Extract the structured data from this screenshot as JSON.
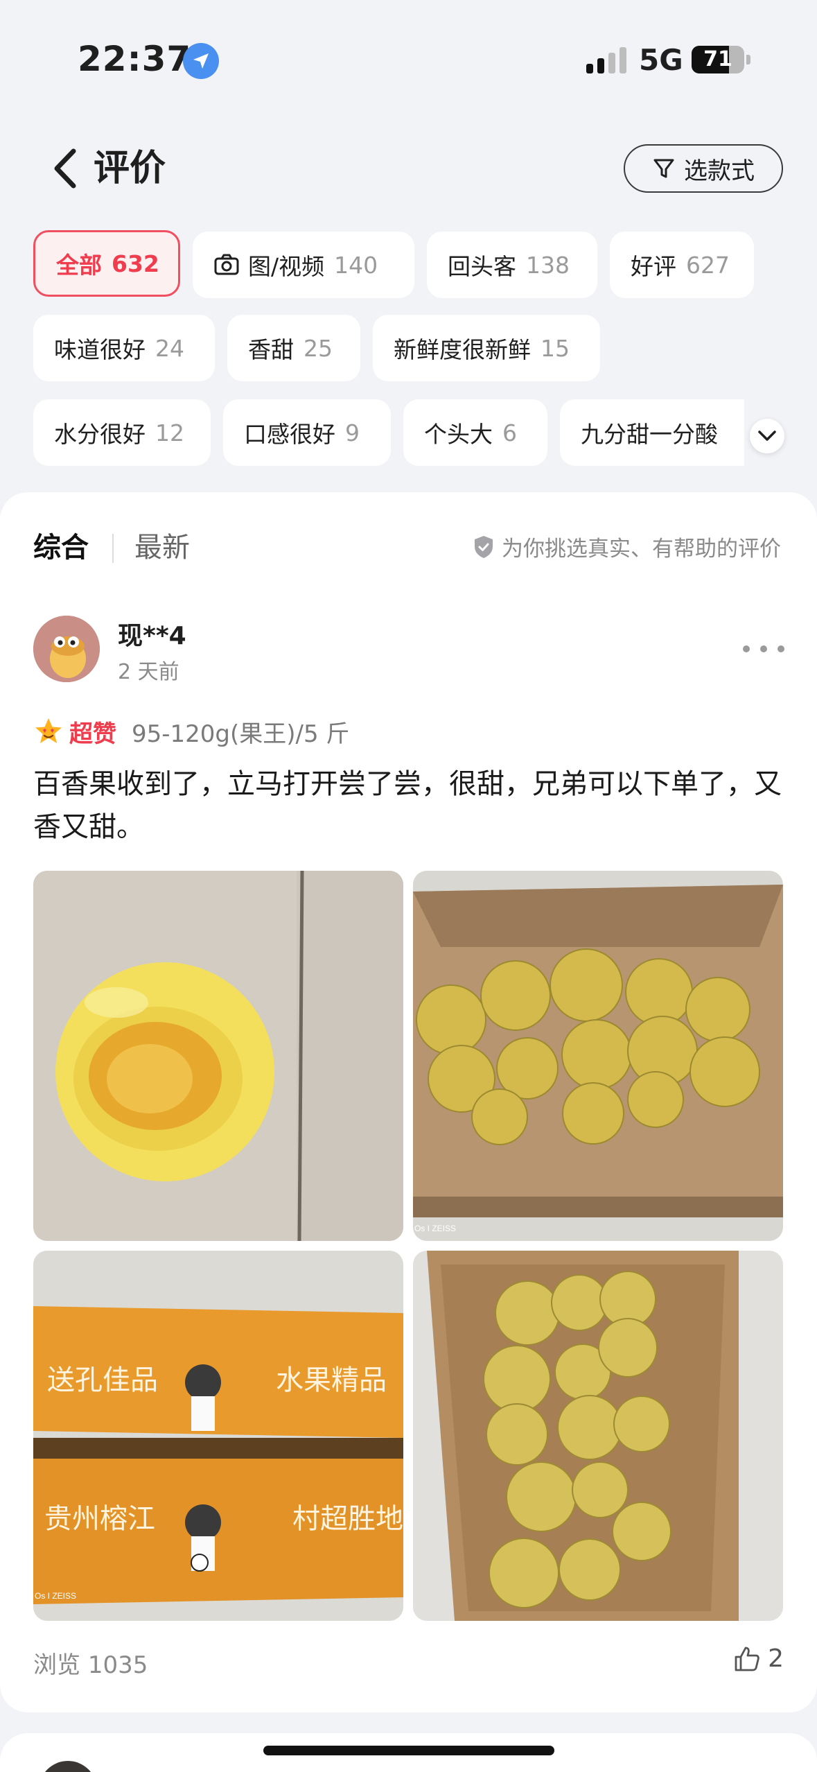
{
  "status_bar": {
    "time": "22:37",
    "network": "5G",
    "battery": "71",
    "battery_level": 0.71
  },
  "header": {
    "title": "评价",
    "filter_button_label": "选款式"
  },
  "chips": [
    {
      "label": "全部",
      "count": "632",
      "active": true
    },
    {
      "label": "图/视频",
      "count": "140",
      "icon": "camera-icon"
    },
    {
      "label": "回头客",
      "count": "138"
    },
    {
      "label": "好评",
      "count": "627"
    },
    {
      "label": "味道很好",
      "count": "24"
    },
    {
      "label": "香甜",
      "count": "25"
    },
    {
      "label": "新鲜度很新鲜",
      "count": "15"
    },
    {
      "label": "水分很好",
      "count": "12"
    },
    {
      "label": "口感很好",
      "count": "9"
    },
    {
      "label": "个头大",
      "count": "6"
    },
    {
      "label": "九分甜一分酸",
      "count": ""
    }
  ],
  "sort_tabs": {
    "overall": "综合",
    "latest": "最新"
  },
  "trust_note": "为你挑选真实、有帮助的评价",
  "review": {
    "user": "现**4",
    "time": "2 天前",
    "rating_label": "超赞",
    "sku": "95-120g(果王)/5 斤",
    "text": "百香果收到了，立马打开尝了尝，很甜，兄弟可以下单了，又香又甜。",
    "views_label": "浏览",
    "views": "1035",
    "likes": "2",
    "photo_texts": {
      "watermark": "Os I ZEISS",
      "box_top_text": "送孔佳品",
      "box_top_text2": "水果精品",
      "box_bottom_text": "贵州榕江",
      "box_bottom_text2": "村超胜地"
    }
  },
  "colors": {
    "accent": "#ef3d4e",
    "background": "#f2f3f7",
    "card": "#ffffff"
  }
}
